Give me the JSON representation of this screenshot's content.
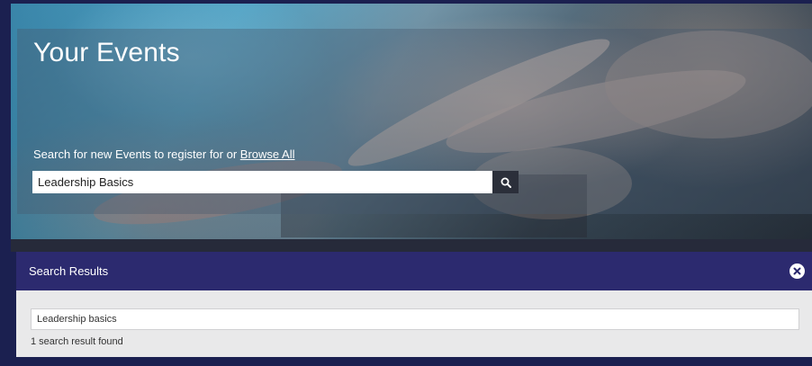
{
  "hero": {
    "title": "Your Events",
    "search_prompt": "Search for new Events to register for or ",
    "browse_link": "Browse All",
    "search_value": "Leadership Basics",
    "search_icon": "search-icon"
  },
  "results": {
    "title": "Search Results",
    "close_icon": "close-circle-icon",
    "items": [
      {
        "label": "Leadership basics"
      }
    ],
    "count_text": "1 search result found"
  },
  "colors": {
    "header_bg": "#2c2a6f",
    "panel_bg": "#e9e9ea",
    "frame_bg": "#1b2050"
  }
}
